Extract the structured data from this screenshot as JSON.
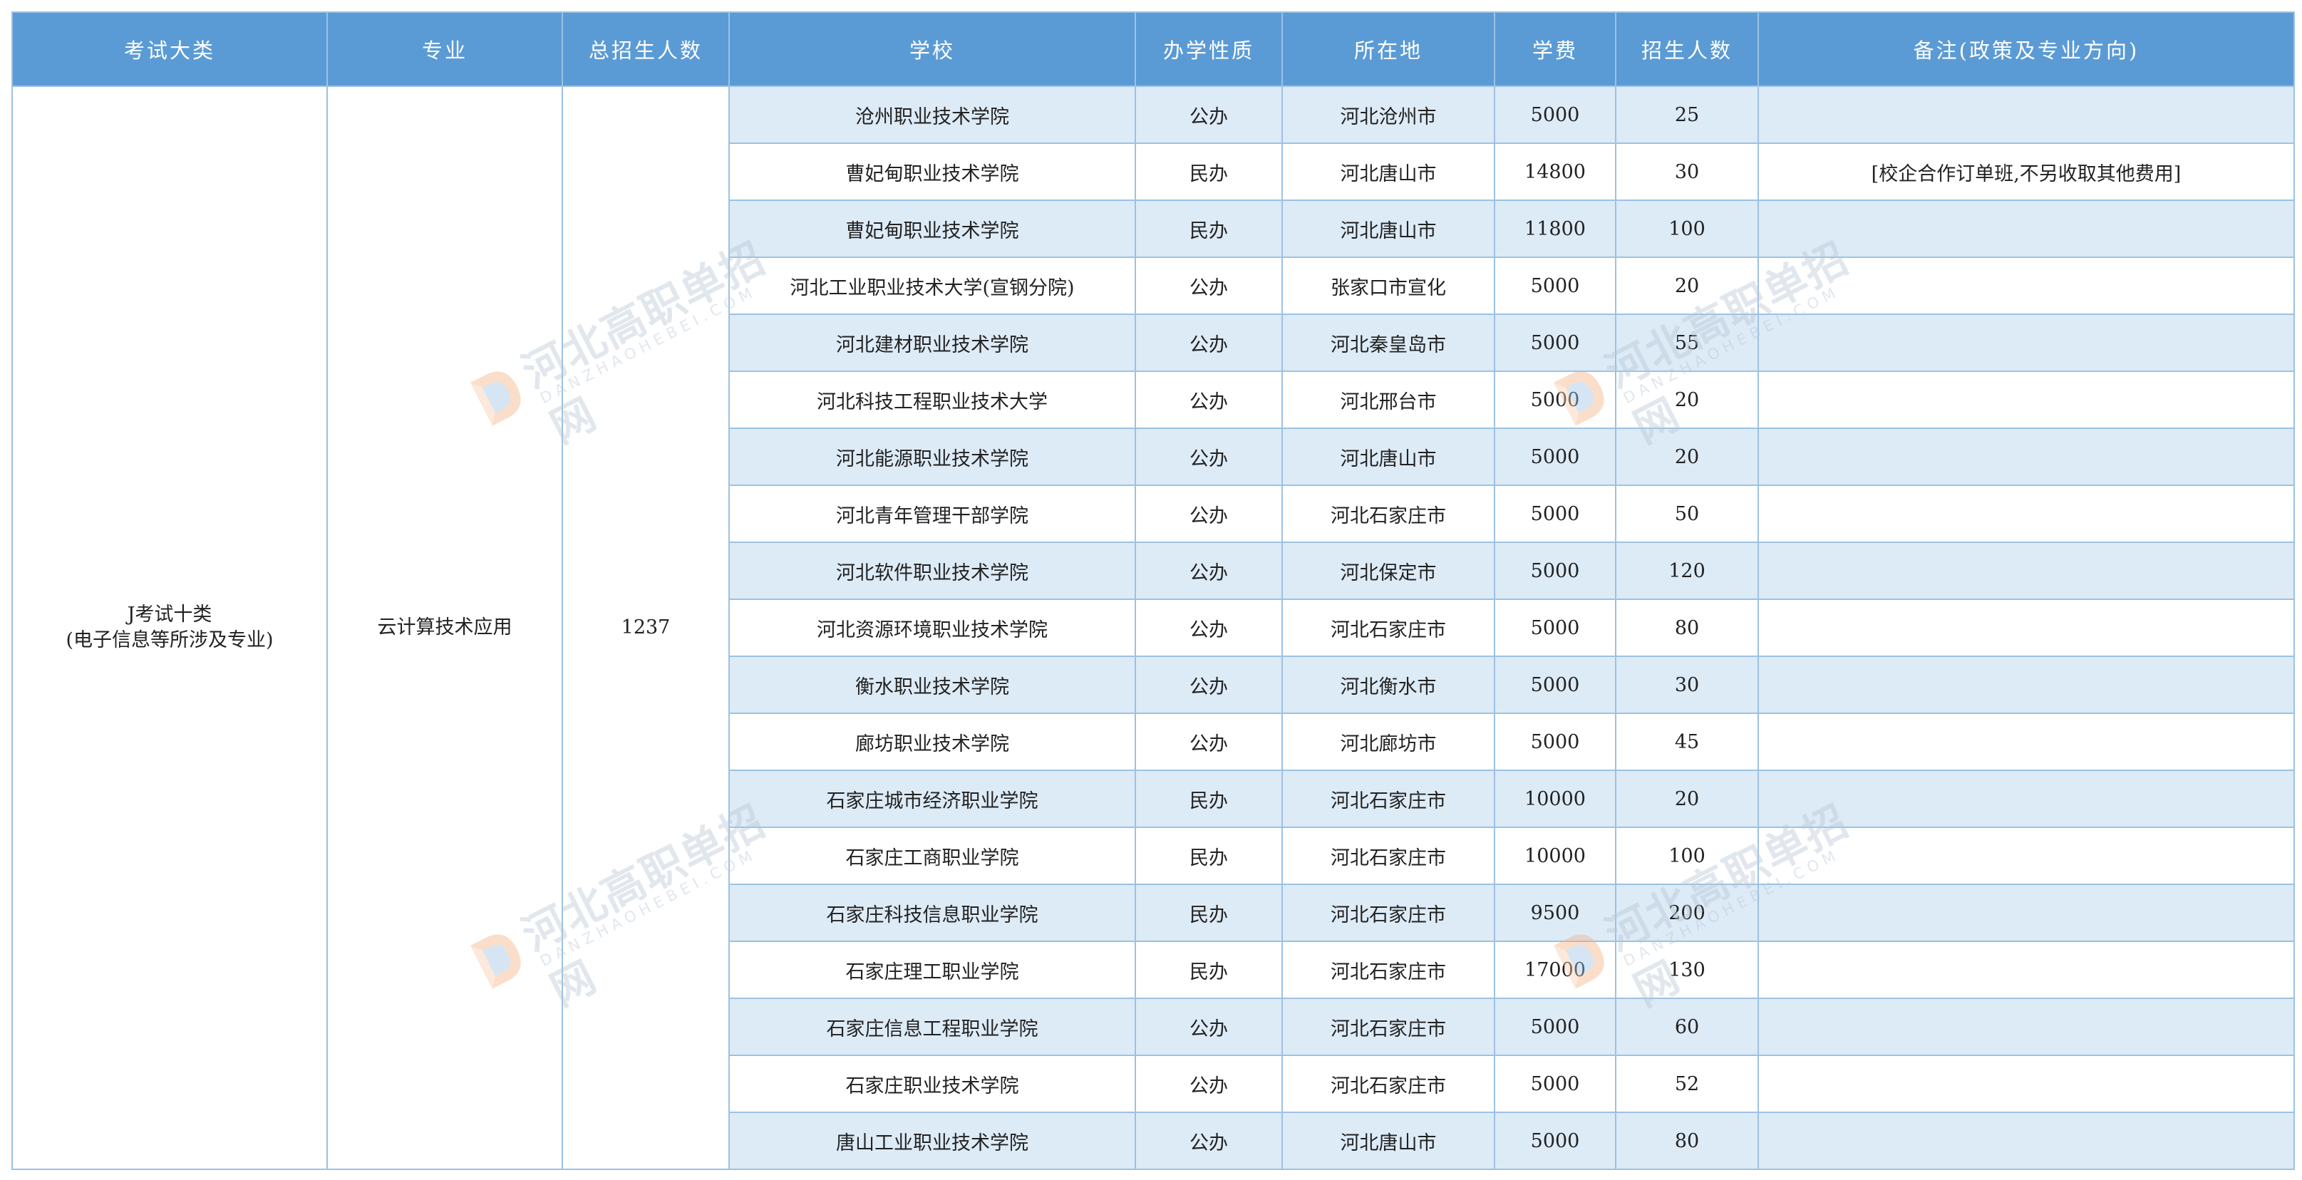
{
  "headers": [
    "考试大类",
    "专业",
    "总招生人数",
    "学校",
    "办学性质",
    "所在地",
    "学费",
    "招生人数",
    "备注(政策及专业方向)"
  ],
  "category": {
    "line1": "J考试十类",
    "line2": "(电子信息等所涉及专业)"
  },
  "major": "云计算技术应用",
  "total": "1237",
  "rows": [
    {
      "school": "沧州职业技术学院",
      "type": "公办",
      "location": "河北沧州市",
      "fee": "5000",
      "quota": "25",
      "note": ""
    },
    {
      "school": "曹妃甸职业技术学院",
      "type": "民办",
      "location": "河北唐山市",
      "fee": "14800",
      "quota": "30",
      "note": "[校企合作订单班,不另收取其他费用]"
    },
    {
      "school": "曹妃甸职业技术学院",
      "type": "民办",
      "location": "河北唐山市",
      "fee": "11800",
      "quota": "100",
      "note": ""
    },
    {
      "school": "河北工业职业技术大学(宣钢分院)",
      "type": "公办",
      "location": "张家口市宣化",
      "fee": "5000",
      "quota": "20",
      "note": ""
    },
    {
      "school": "河北建材职业技术学院",
      "type": "公办",
      "location": "河北秦皇岛市",
      "fee": "5000",
      "quota": "55",
      "note": ""
    },
    {
      "school": "河北科技工程职业技术大学",
      "type": "公办",
      "location": "河北邢台市",
      "fee": "5000",
      "quota": "20",
      "note": ""
    },
    {
      "school": "河北能源职业技术学院",
      "type": "公办",
      "location": "河北唐山市",
      "fee": "5000",
      "quota": "20",
      "note": ""
    },
    {
      "school": "河北青年管理干部学院",
      "type": "公办",
      "location": "河北石家庄市",
      "fee": "5000",
      "quota": "50",
      "note": ""
    },
    {
      "school": "河北软件职业技术学院",
      "type": "公办",
      "location": "河北保定市",
      "fee": "5000",
      "quota": "120",
      "note": ""
    },
    {
      "school": "河北资源环境职业技术学院",
      "type": "公办",
      "location": "河北石家庄市",
      "fee": "5000",
      "quota": "80",
      "note": ""
    },
    {
      "school": "衡水职业技术学院",
      "type": "公办",
      "location": "河北衡水市",
      "fee": "5000",
      "quota": "30",
      "note": ""
    },
    {
      "school": "廊坊职业技术学院",
      "type": "公办",
      "location": "河北廊坊市",
      "fee": "5000",
      "quota": "45",
      "note": ""
    },
    {
      "school": "石家庄城市经济职业学院",
      "type": "民办",
      "location": "河北石家庄市",
      "fee": "10000",
      "quota": "20",
      "note": ""
    },
    {
      "school": "石家庄工商职业学院",
      "type": "民办",
      "location": "河北石家庄市",
      "fee": "10000",
      "quota": "100",
      "note": ""
    },
    {
      "school": "石家庄科技信息职业学院",
      "type": "民办",
      "location": "河北石家庄市",
      "fee": "9500",
      "quota": "200",
      "note": ""
    },
    {
      "school": "石家庄理工职业学院",
      "type": "民办",
      "location": "河北石家庄市",
      "fee": "17000",
      "quota": "130",
      "note": ""
    },
    {
      "school": "石家庄信息工程职业学院",
      "type": "公办",
      "location": "河北石家庄市",
      "fee": "5000",
      "quota": "60",
      "note": ""
    },
    {
      "school": "石家庄职业技术学院",
      "type": "公办",
      "location": "河北石家庄市",
      "fee": "5000",
      "quota": "52",
      "note": ""
    },
    {
      "school": "唐山工业职业技术学院",
      "type": "公办",
      "location": "河北唐山市",
      "fee": "5000",
      "quota": "80",
      "note": ""
    }
  ],
  "watermark": {
    "title": "河北高职单招网",
    "subtitle": "DANZHAOHEBEI.COM"
  },
  "colors": {
    "header_bg": "#5b9bd5",
    "header_text": "#ffffff",
    "stripe": "#ddebf7",
    "border": "#9cc2e3",
    "watermark": "#b9c7d6"
  }
}
